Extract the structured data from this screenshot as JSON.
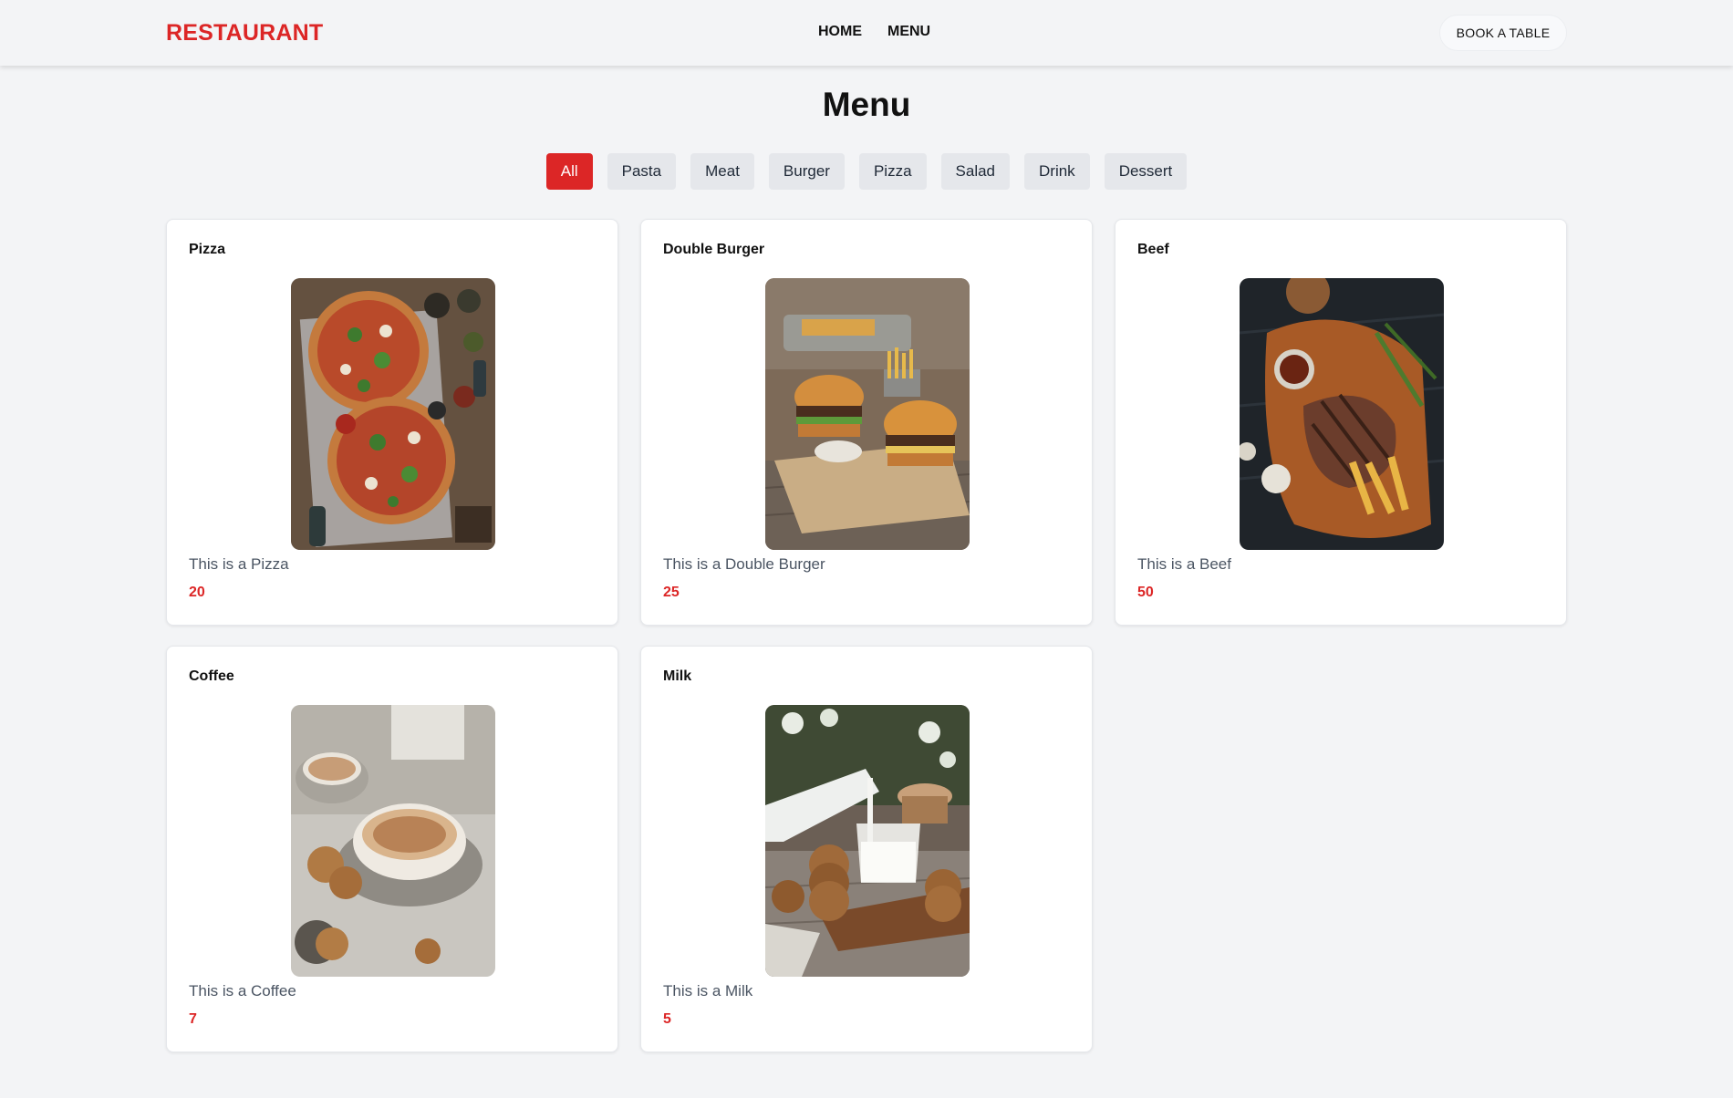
{
  "header": {
    "logo": "RESTAURANT",
    "nav": [
      "HOME",
      "MENU"
    ],
    "book_button": "BOOK A TABLE"
  },
  "page_title": "Menu",
  "filters": {
    "items": [
      "All",
      "Pasta",
      "Meat",
      "Burger",
      "Pizza",
      "Salad",
      "Drink",
      "Dessert"
    ],
    "active": "All"
  },
  "menu_items": [
    {
      "name": "Pizza",
      "description": "This is a Pizza",
      "price": "20",
      "image": "pizza-photo"
    },
    {
      "name": "Double Burger",
      "description": "This is a Double Burger",
      "price": "25",
      "image": "burger-photo"
    },
    {
      "name": "Beef",
      "description": "This is a Beef",
      "price": "50",
      "image": "steak-photo"
    },
    {
      "name": "Coffee",
      "description": "This is a Coffee",
      "price": "7",
      "image": "coffee-photo"
    },
    {
      "name": "Milk",
      "description": "This is a Milk",
      "price": "5",
      "image": "milk-photo"
    }
  ],
  "colors": {
    "brand": "#dc2626",
    "background": "#f3f4f6",
    "filter_bg": "#e5e7eb"
  }
}
